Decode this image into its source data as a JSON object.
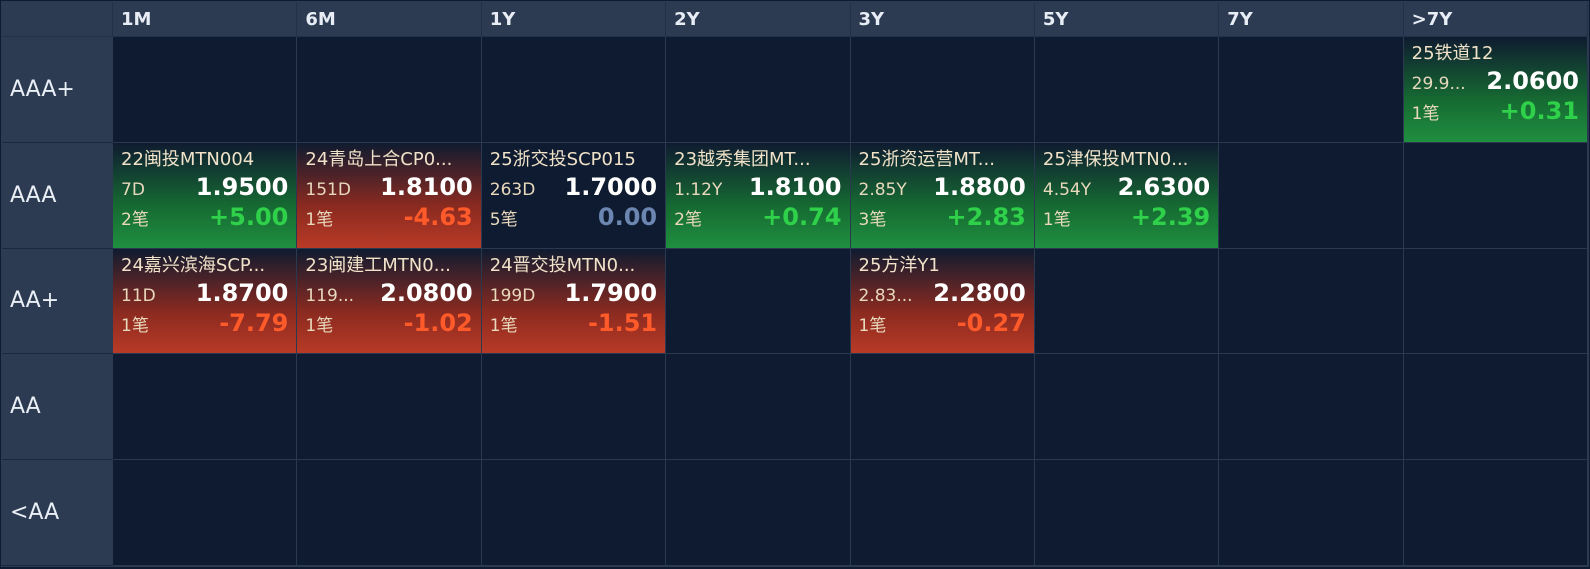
{
  "columns": [
    "1M",
    "6M",
    "1Y",
    "2Y",
    "3Y",
    "5Y",
    "7Y",
    ">7Y"
  ],
  "rows": [
    "AAA+",
    "AAA",
    "AA+",
    "AA",
    "<AA"
  ],
  "colors": {
    "up": "#2fd14a",
    "down": "#ff5a2a",
    "flat": "#6b86b0",
    "background": "#0f1b30",
    "header": "#2c3a52"
  },
  "cards": [
    {
      "row": 0,
      "col": 7,
      "name": "25铁道12",
      "term": "29.9...",
      "yield": "2.0600",
      "count": "1笔",
      "change": "+0.31",
      "trend": "green"
    },
    {
      "row": 1,
      "col": 0,
      "name": "22闽投MTN004",
      "term": "7D",
      "yield": "1.9500",
      "count": "2笔",
      "change": "+5.00",
      "trend": "green"
    },
    {
      "row": 1,
      "col": 1,
      "name": "24青岛上合CP0...",
      "term": "151D",
      "yield": "1.8100",
      "count": "1笔",
      "change": "-4.63",
      "trend": "red"
    },
    {
      "row": 1,
      "col": 2,
      "name": "25浙交投SCP015",
      "term": "263D",
      "yield": "1.7000",
      "count": "5笔",
      "change": "0.00",
      "trend": "flat"
    },
    {
      "row": 1,
      "col": 3,
      "name": "23越秀集团MT...",
      "term": "1.12Y",
      "yield": "1.8100",
      "count": "2笔",
      "change": "+0.74",
      "trend": "green"
    },
    {
      "row": 1,
      "col": 4,
      "name": "25浙资运营MT...",
      "term": "2.85Y",
      "yield": "1.8800",
      "count": "3笔",
      "change": "+2.83",
      "trend": "green"
    },
    {
      "row": 1,
      "col": 5,
      "name": "25津保投MTN0...",
      "term": "4.54Y",
      "yield": "2.6300",
      "count": "1笔",
      "change": "+2.39",
      "trend": "green"
    },
    {
      "row": 2,
      "col": 0,
      "name": "24嘉兴滨海SCP...",
      "term": "11D",
      "yield": "1.8700",
      "count": "1笔",
      "change": "-7.79",
      "trend": "red"
    },
    {
      "row": 2,
      "col": 1,
      "name": "23闽建工MTN0...",
      "term": "119...",
      "yield": "2.0800",
      "count": "1笔",
      "change": "-1.02",
      "trend": "red"
    },
    {
      "row": 2,
      "col": 2,
      "name": "24晋交投MTN0...",
      "term": "199D",
      "yield": "1.7900",
      "count": "1笔",
      "change": "-1.51",
      "trend": "red"
    },
    {
      "row": 2,
      "col": 4,
      "name": "25方洋Y1",
      "term": "2.83...",
      "yield": "2.2800",
      "count": "1笔",
      "change": "-0.27",
      "trend": "red"
    }
  ]
}
